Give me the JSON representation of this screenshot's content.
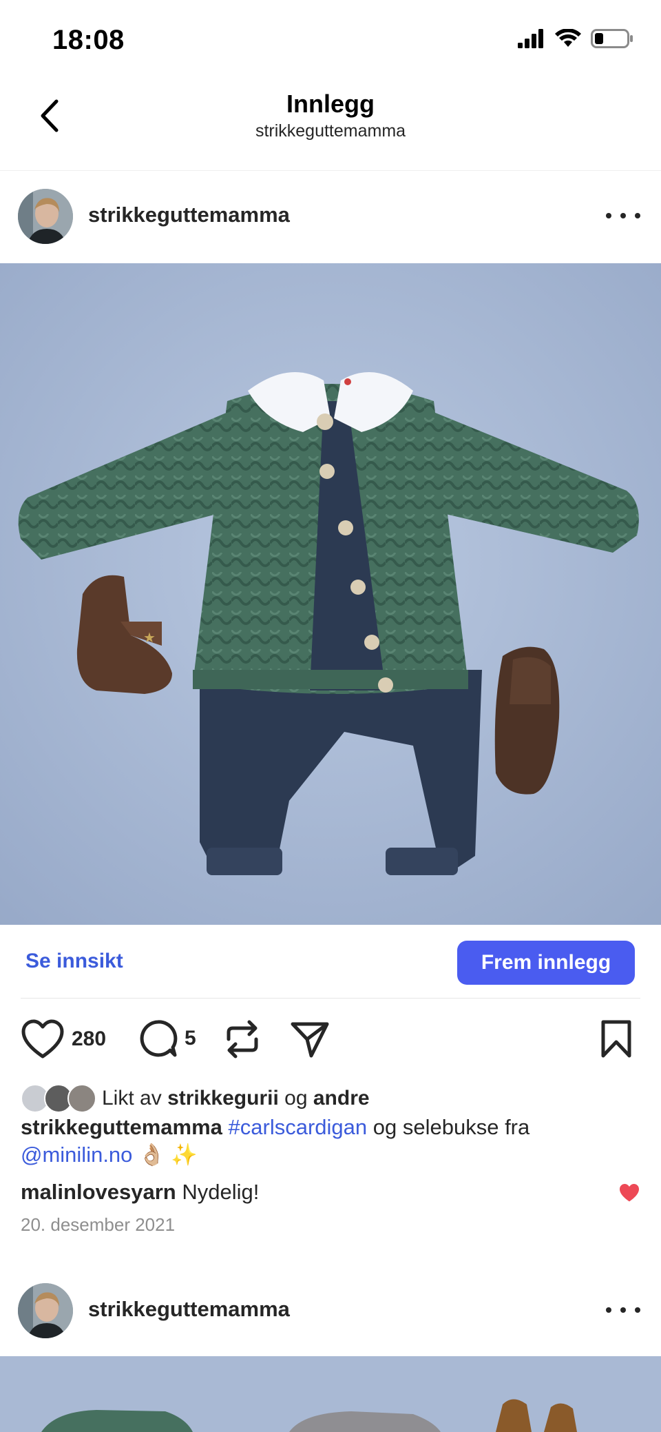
{
  "status_bar": {
    "time": "18:08"
  },
  "nav": {
    "title": "Innlegg",
    "subtitle": "strikkeguttemamma"
  },
  "post": {
    "username": "strikkeguttemamma",
    "insights_label": "Se innsikt",
    "promote_label": "Frem innlegg",
    "likes_count": "280",
    "comments_count": "5",
    "liked_by_prefix": "Likt av",
    "liked_by_user": "strikkegurii",
    "liked_by_and": "og",
    "liked_by_others": "andre",
    "caption_user": "strikkeguttemamma",
    "caption_hashtag": "#carlscardigan",
    "caption_text": "og selebukse fra",
    "caption_mention": "@minilin.no",
    "caption_emoji": "👌🏼 ✨",
    "comment_user": "malinlovesyarn",
    "comment_text": "Nydelig!",
    "date": "20. desember 2021"
  },
  "next_post": {
    "username": "strikkeguttemamma"
  },
  "colors": {
    "accent": "#4a5cf0",
    "link": "#3b5bdb",
    "heart": "#ed4956",
    "background_photo": "#a9b9d4"
  },
  "icons": [
    "back-chevron-icon",
    "signal-icon",
    "wifi-icon",
    "battery-icon",
    "more-icon",
    "heart-icon",
    "comment-icon",
    "repost-icon",
    "share-icon",
    "bookmark-icon"
  ]
}
